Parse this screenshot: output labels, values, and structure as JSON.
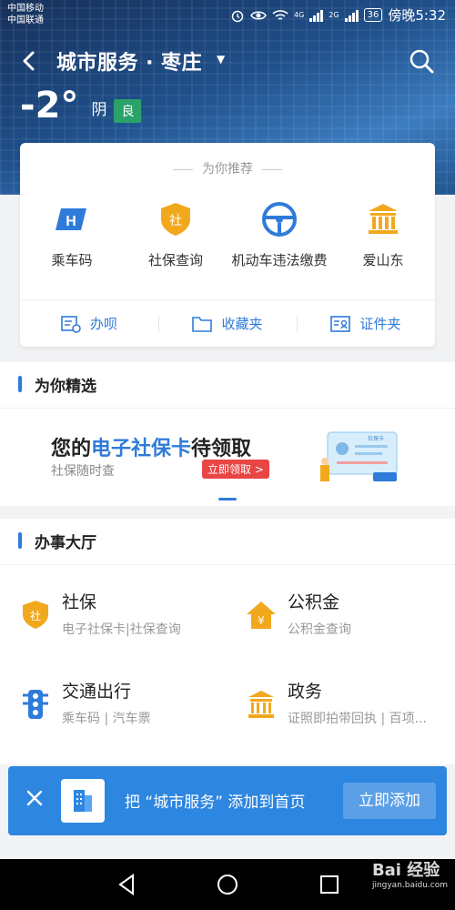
{
  "status_bar": {
    "carrier1": "中国移动",
    "carrier2": "中国联通",
    "network1": "4G",
    "network2": "2G",
    "battery": "36",
    "time": "傍晚5:32"
  },
  "header": {
    "title": "城市服务 · 枣庄",
    "caret": "▼"
  },
  "weather": {
    "temperature": "-2°",
    "condition": "阴",
    "air_quality": "良"
  },
  "recommend": {
    "heading": "为你推荐",
    "items": [
      {
        "label": "乘车码",
        "icon": "bus-code-icon"
      },
      {
        "label": "社保查询",
        "icon": "social-security-icon"
      },
      {
        "label": "机动车违法缴费",
        "icon": "steering-wheel-icon"
      },
      {
        "label": "爱山东",
        "icon": "government-building-icon"
      }
    ],
    "footer": [
      {
        "label": "办呗",
        "icon": "handle-icon"
      },
      {
        "label": "收藏夹",
        "icon": "folder-icon"
      },
      {
        "label": "证件夹",
        "icon": "id-card-icon"
      }
    ]
  },
  "featured": {
    "heading": "为你精选",
    "banner_prefix": "您的",
    "banner_highlight": "电子社保卡",
    "banner_suffix": "待领取",
    "banner_sub": "社保随时查",
    "banner_button": "立即领取 >",
    "card_text": "社保卡"
  },
  "hall": {
    "heading": "办事大厅",
    "services": [
      {
        "name": "社保",
        "desc": "电子社保卡|社保查询",
        "icon": "social-security-icon"
      },
      {
        "name": "公积金",
        "desc": "公积金查询",
        "icon": "housing-fund-icon"
      },
      {
        "name": "交通出行",
        "desc": "乘车码 | 汽车票",
        "icon": "traffic-light-icon"
      },
      {
        "name": "政务",
        "desc": "证照即拍带回执 | 百项...",
        "icon": "government-building-icon"
      }
    ]
  },
  "toast": {
    "message": "把 “城市服务” 添加到首页",
    "button": "立即添加"
  },
  "watermark": {
    "brand": "Bai 经验",
    "url": "jingyan.baidu.com"
  },
  "colors": {
    "accent": "#2f7bd9",
    "toast_bg": "#2d86e0",
    "aqi_green": "#2aa26a",
    "icon_orange": "#f2a81d",
    "badge_red": "#e94545"
  }
}
